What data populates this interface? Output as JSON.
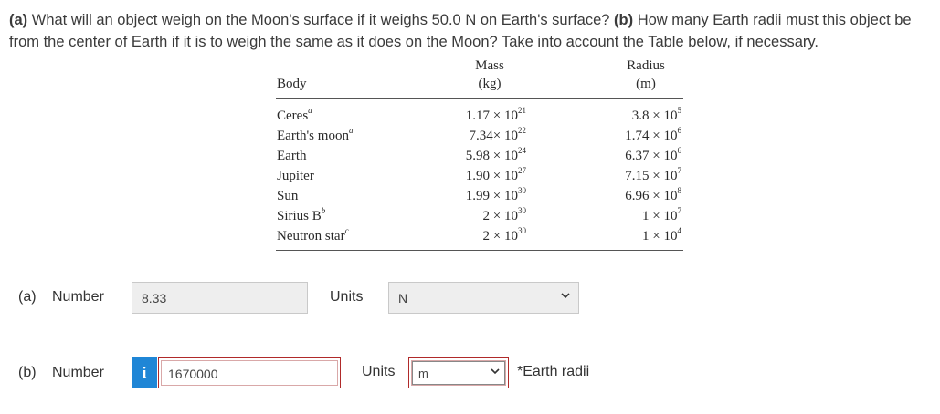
{
  "question": {
    "a_prefix": "(a)",
    "a_text": " What will an object weigh on the Moon's surface if it weighs 50.0 N on Earth's surface? ",
    "b_prefix": "(b)",
    "b_text": " How many Earth radii must this object be from the center of Earth if it is to weigh the same as it does on the Moon? Take into account the Table below, if necessary."
  },
  "table": {
    "header_body": "Body",
    "header_mass_line1": "Mass",
    "header_mass_line2": "(kg)",
    "header_radius_line1": "Radius",
    "header_radius_line2": "(m)",
    "rows": [
      {
        "body": "Ceres",
        "note": "a",
        "mass_coef": "1.17 × 10",
        "mass_exp": "21",
        "radius_coef": "3.8 × 10",
        "radius_exp": "5"
      },
      {
        "body": "Earth's moon",
        "note": "a",
        "mass_coef": "7.34× 10",
        "mass_exp": "22",
        "radius_coef": "1.74 × 10",
        "radius_exp": "6"
      },
      {
        "body": "Earth",
        "note": "",
        "mass_coef": "5.98 × 10",
        "mass_exp": "24",
        "radius_coef": "6.37 × 10",
        "radius_exp": "6"
      },
      {
        "body": "Jupiter",
        "note": "",
        "mass_coef": "1.90 × 10",
        "mass_exp": "27",
        "radius_coef": "7.15 × 10",
        "radius_exp": "7"
      },
      {
        "body": "Sun",
        "note": "",
        "mass_coef": "1.99 × 10",
        "mass_exp": "30",
        "radius_coef": "6.96 × 10",
        "radius_exp": "8"
      },
      {
        "body": "Sirius B",
        "note": "b",
        "mass_coef": "2 × 10",
        "mass_exp": "30",
        "radius_coef": "1 × 10",
        "radius_exp": "7"
      },
      {
        "body": "Neutron star",
        "note": "c",
        "mass_coef": "2 × 10",
        "mass_exp": "30",
        "radius_coef": "1 × 10",
        "radius_exp": "4"
      }
    ]
  },
  "part_a": {
    "label": "(a)",
    "number_label": "Number",
    "value": "8.33",
    "units_label": "Units",
    "unit_selected": "N"
  },
  "part_b": {
    "label": "(b)",
    "number_label": "Number",
    "info_icon": "i",
    "value": "1670000",
    "units_label": "Units",
    "unit_selected": "m",
    "note": "*Earth radii"
  },
  "colors": {
    "info_blue": "#1f86d6",
    "error_red": "#b02a2a",
    "disabled_gray": "#eeeeee"
  }
}
